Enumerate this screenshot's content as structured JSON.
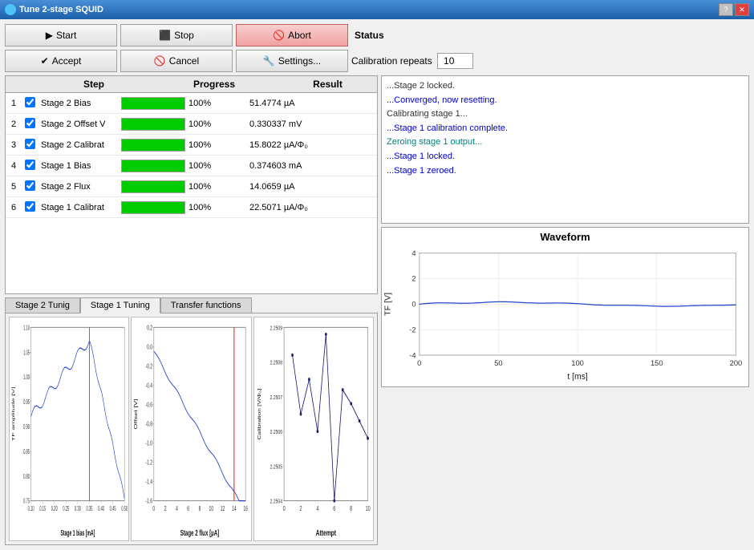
{
  "titleBar": {
    "title": "Tune 2-stage SQUID",
    "closeBtn": "✕",
    "minBtn": "─",
    "maxBtn": "□"
  },
  "toolbar": {
    "startLabel": "Start",
    "stopLabel": "Stop",
    "abortLabel": "Abort",
    "acceptLabel": "Accept",
    "cancelLabel": "Cancel",
    "settingsLabel": "Settings...",
    "calRepeatsLabel": "Calibration repeats",
    "calRepeatsValue": "10",
    "statusLabel": "Status"
  },
  "tableHeaders": {
    "step": "Step",
    "progress": "Progress",
    "result": "Result"
  },
  "tableRows": [
    {
      "num": "1",
      "checked": true,
      "step": "Stage 2 Bias",
      "pct": "100%",
      "result": "51.4774 µA"
    },
    {
      "num": "2",
      "checked": true,
      "step": "Stage 2 Offset V",
      "pct": "100%",
      "result": "0.330337 mV"
    },
    {
      "num": "3",
      "checked": true,
      "step": "Stage 2 Calibrat",
      "pct": "100%",
      "result": "15.8022 µA/Φ₀"
    },
    {
      "num": "4",
      "checked": true,
      "step": "Stage 1 Bias",
      "pct": "100%",
      "result": "0.374603 mA"
    },
    {
      "num": "5",
      "checked": true,
      "step": "Stage 2 Flux",
      "pct": "100%",
      "result": "14.0659 µA"
    },
    {
      "num": "6",
      "checked": true,
      "step": "Stage 1 Calibrat",
      "pct": "100%",
      "result": "22.5071 µA/Φ₀"
    }
  ],
  "statusLines": [
    {
      "text": "...Stage 2 locked.",
      "style": "normal"
    },
    {
      "text": "...Converged, now resetting.",
      "style": "blue"
    },
    {
      "text": "Calibrating stage 1...",
      "style": "normal"
    },
    {
      "text": "...Stage 1 calibration complete.",
      "style": "blue"
    },
    {
      "text": "Zeroing stage 1 output...",
      "style": "teal"
    },
    {
      "text": "...Stage 1 locked.",
      "style": "blue"
    },
    {
      "text": "...Stage 1 zeroed.",
      "style": "blue"
    }
  ],
  "waveform": {
    "title": "Waveform",
    "xLabel": "t [ms]",
    "yLabel": "TF [V]",
    "xMin": 0,
    "xMax": 200,
    "yMin": -4,
    "yMax": 4,
    "xTicks": [
      0,
      50,
      100,
      150,
      200
    ],
    "yTicks": [
      4,
      2,
      0,
      -2,
      -4
    ]
  },
  "tabs": [
    {
      "id": "stage2tuning",
      "label": "Stage 2 Tunig"
    },
    {
      "id": "stage1tuning",
      "label": "Stage 1 Tuning",
      "active": true
    },
    {
      "id": "transferfunctions",
      "label": "Transfer functions"
    }
  ],
  "plot1": {
    "xLabel": "Stage 1 bias [mA]",
    "yLabel": "TF amplitude [V]",
    "xMin": 0.1,
    "xMax": 0.5,
    "yMin": 0.75,
    "yMax": 1.1,
    "redLineX": 0.35
  },
  "plot2": {
    "xLabel": "Stage 2 flux [µA]",
    "yLabel": "Offset [V]",
    "xMin": 0,
    "xMax": 16,
    "yMin": -1.6,
    "yMax": 0.2,
    "redLineX": 14
  },
  "plot3": {
    "xLabel": "Attempt",
    "yLabel": "Calibration [V/Φ₀]",
    "xMin": 0,
    "xMax": 10,
    "yMin": 2.2504,
    "yMax": 2.2509,
    "redLineX": null
  }
}
